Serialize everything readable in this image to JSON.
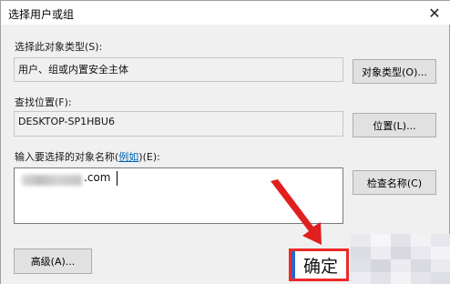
{
  "dialog": {
    "title": "选择用户或组",
    "close_icon": "close-icon",
    "object_types_label": "选择此对象类型(S):",
    "object_types_value": "用户、组或内置安全主体",
    "object_types_button": "对象类型(O)...",
    "location_label": "查找位置(F):",
    "location_value": "DESKTOP-SP1HBU6",
    "location_button": "位置(L)...",
    "names_label_prefix": "输入要选择的对象名称(",
    "names_label_link": "例如",
    "names_label_suffix": ")(E):",
    "names_value_visible": ".com",
    "check_names_button": "检查名称(C)",
    "advanced_button": "高级(A)...",
    "ok_button": "确定"
  },
  "colors": {
    "highlight": "#ee2a2a",
    "link": "#0063b1",
    "accent": "#2a66c9"
  }
}
